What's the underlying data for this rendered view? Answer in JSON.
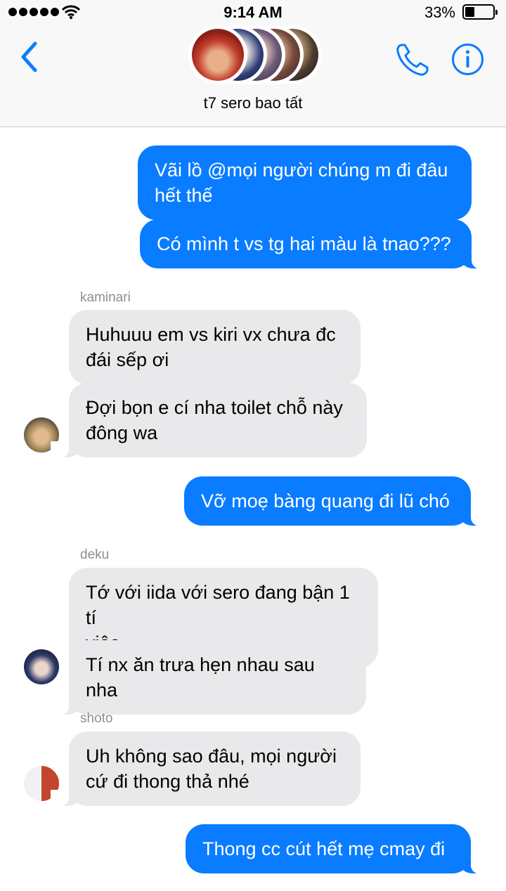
{
  "status_bar": {
    "time": "9:14 AM",
    "battery_percent": "33%",
    "battery_level": 0.33,
    "signal_bars": 5,
    "wifi_icon": "wifi-icon"
  },
  "header": {
    "back_icon": "chevron-left-icon",
    "group_name": "t7 sero bao tất",
    "call_icon": "phone-icon",
    "info_icon": "info-icon",
    "avatar_count": 5
  },
  "colors": {
    "outgoing_bubble": "#0a7cff",
    "incoming_bubble": "#e9e9eb",
    "accent": "#0a7cff"
  },
  "messages": [
    {
      "direction": "out",
      "text_lines": [
        "Vãi lồ @mọi người chúng m đi đâu",
        "hết thế"
      ]
    },
    {
      "direction": "out",
      "text_lines": [
        "Có mình t vs tg hai màu là tnao???"
      ]
    },
    {
      "direction": "in",
      "sender": "kaminari",
      "text_lines": [
        "Huhuuu em vs kiri vx chưa đc",
        "đái sếp ơi"
      ]
    },
    {
      "direction": "in",
      "text_lines": [
        "Đợi bọn e cí nha toilet chỗ này",
        "đông wa"
      ]
    },
    {
      "direction": "out",
      "text_lines": [
        "Vỡ moẹ bàng quang đi lũ chó"
      ]
    },
    {
      "direction": "in",
      "sender": "deku",
      "text_lines": [
        "Tớ với iida với sero đang bận 1 tí",
        "việc"
      ]
    },
    {
      "direction": "in",
      "text_lines": [
        "Tí nx ăn trưa hẹn nhau sau nha"
      ]
    },
    {
      "direction": "in",
      "sender": "shoto",
      "text_lines": [
        "Uh không sao đâu, mọi người",
        "cứ đi thong thả nhé"
      ]
    },
    {
      "direction": "out",
      "text_lines": [
        "Thong cc cút hết mẹ cmay đi"
      ]
    }
  ]
}
